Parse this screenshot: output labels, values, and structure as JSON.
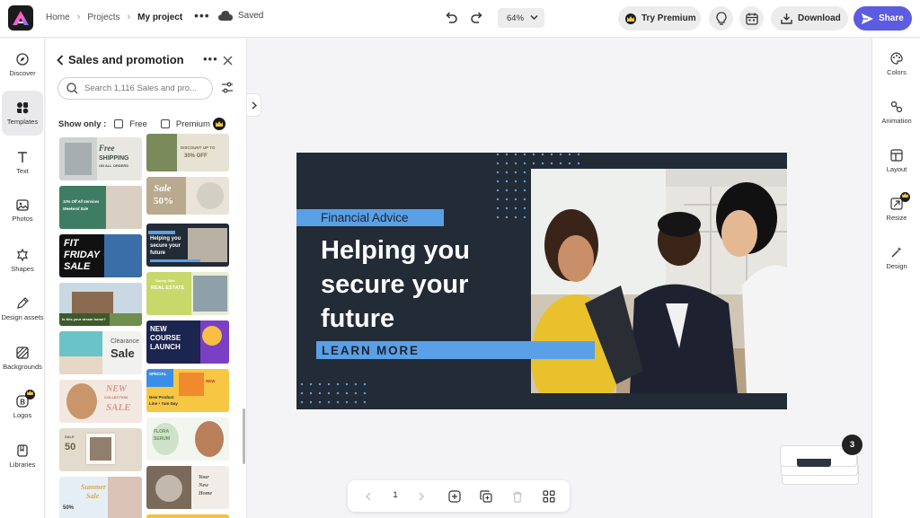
{
  "app": {
    "logo": "adobe-express-logo"
  },
  "breadcrumbs": {
    "home": "Home",
    "projects": "Projects",
    "current": "My project"
  },
  "header": {
    "more_icon": "ellipsis-icon",
    "save_status": "Saved",
    "zoom": "64%",
    "try_premium": "Try Premium",
    "download": "Download",
    "share": "Share"
  },
  "left_rail": [
    {
      "label": "Discover",
      "icon": "compass-icon"
    },
    {
      "label": "Templates",
      "icon": "templates-icon",
      "active": true
    },
    {
      "label": "Text",
      "icon": "text-icon"
    },
    {
      "label": "Photos",
      "icon": "photo-icon"
    },
    {
      "label": "Shapes",
      "icon": "shapes-icon"
    },
    {
      "label": "Design assets",
      "icon": "design-assets-icon"
    },
    {
      "label": "Backgrounds",
      "icon": "backgrounds-icon"
    },
    {
      "label": "Logos",
      "icon": "logo-icon",
      "premium": true
    },
    {
      "label": "Libraries",
      "icon": "libraries-icon"
    }
  ],
  "panel": {
    "title": "Sales and promotion",
    "search_placeholder": "Search 1,116 Sales and pro...",
    "show_only": "Show only :",
    "filter_free": "Free",
    "filter_premium": "Premium"
  },
  "templates": [
    {
      "lines": [
        "Free",
        "SHIPPING",
        "ON ALL ORDERS"
      ],
      "bg": "#e9e7e2",
      "fg": "#3a5248"
    },
    {
      "lines": [
        "DISCOUNT UP TO",
        "30% OFF"
      ],
      "bg": "#e6e2d4",
      "fg": "#7a6d47"
    },
    {
      "lines": [
        "10% Off All Services",
        "Weekend Sale"
      ],
      "bg": "#3e7d64",
      "fg": "#ffffff"
    },
    {
      "lines": [
        "Sale",
        "50%"
      ],
      "bg": "#e9e3d9",
      "fg": "#ffffff"
    },
    {
      "lines": [
        "FIT",
        "FRIDAY",
        "SALE"
      ],
      "bg": "#111111",
      "fg": "#ffffff"
    },
    {
      "lines": [
        "Helping you",
        "secure your",
        "future"
      ],
      "bg": "#222b36",
      "fg": "#ffffff"
    },
    {
      "lines": [
        "Is this your dream home?"
      ],
      "bg": "#6f8f4c",
      "fg": "#ffffff"
    },
    {
      "lines": [
        "Sunny Side",
        "REAL ESTATE"
      ],
      "bg": "#c8d86b",
      "fg": "#ffffff"
    },
    {
      "lines": [
        "Clearance",
        "Sale"
      ],
      "bg": "#f1f1ef",
      "fg": "#333333"
    },
    {
      "lines": [
        "NEW",
        "COURSE",
        "LAUNCH"
      ],
      "bg": "#1c2450",
      "fg": "#ffffff"
    },
    {
      "lines": [
        "NEW",
        "COLLECTION",
        "SALE"
      ],
      "bg": "#f3e8e0",
      "fg": "#d89a8a"
    },
    {
      "lines": [
        "SPECIAL",
        "NEW",
        "New Product",
        "Line • 7am Day"
      ],
      "bg": "#f7c744",
      "fg": "#2d2d2d"
    },
    {
      "lines": [
        "SALE",
        "50"
      ],
      "bg": "#e3dbcd",
      "fg": "#6e5f4a"
    },
    {
      "lines": [
        "FLORA",
        "SERUM"
      ],
      "bg": "#f3f6ef",
      "fg": "#6d8f62"
    },
    {
      "lines": [
        "Summer",
        "Sale",
        "50%"
      ],
      "bg": "#e6eef5",
      "fg": "#e0a83d"
    },
    {
      "lines": [
        "Your",
        "New",
        "Home"
      ],
      "bg": "#f1ece7",
      "fg": "#555555"
    }
  ],
  "canvas": {
    "tag": "Financial Advice",
    "headline": "Helping you secure your future",
    "cta": "LEARN MORE",
    "colors": {
      "background": "#222b36",
      "accent": "#5aa0e6"
    }
  },
  "right_rail": [
    {
      "label": "Colors",
      "icon": "palette-icon"
    },
    {
      "label": "Animation",
      "icon": "animation-icon"
    },
    {
      "label": "Layout",
      "icon": "layout-icon"
    },
    {
      "label": "Resize",
      "icon": "resize-icon",
      "premium": true
    },
    {
      "label": "Design",
      "icon": "magic-wand-icon"
    }
  ],
  "bottom_toolbar": {
    "page": "1"
  },
  "pages": {
    "count": "3"
  },
  "colors": {
    "accent": "#5c5ce0",
    "premium_badge": "#1c1c1c",
    "premium_crown": "#f6c543"
  }
}
